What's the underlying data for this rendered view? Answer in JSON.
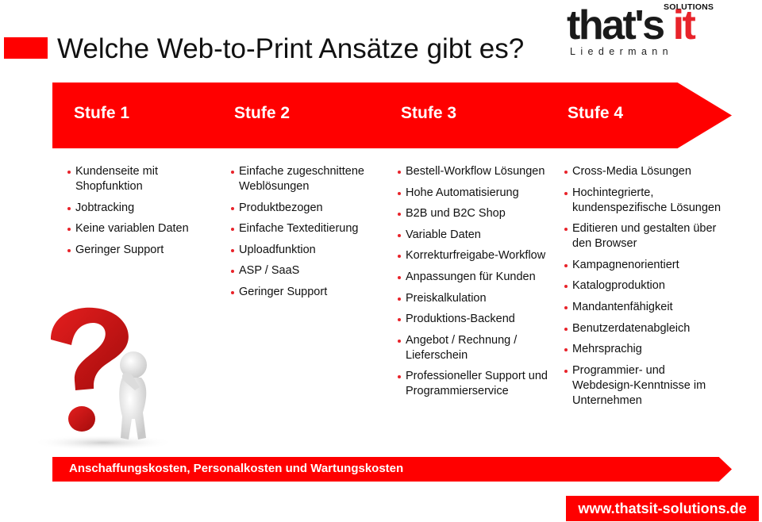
{
  "header": {
    "title": "Welche Web-to-Print Ansätze gibt es?"
  },
  "logo": {
    "wordmark_main": "that's ",
    "wordmark_accent": "it",
    "tagline_top": "SOLUTIONS",
    "tagline_bottom": "Liedermann"
  },
  "stages": [
    {
      "label": "Stufe 1",
      "items": [
        "Kundenseite mit Shopfunktion",
        "Jobtracking",
        "Keine variablen Daten",
        "Geringer Support"
      ]
    },
    {
      "label": "Stufe 2",
      "items": [
        "Einfache zugeschnittene Weblösungen",
        "Produktbezogen",
        "Einfache Texteditierung",
        "Uploadfunktion",
        "ASP / SaaS",
        "Geringer Support"
      ]
    },
    {
      "label": "Stufe 3",
      "items": [
        "Bestell-Workflow Lösungen",
        "Hohe Automatisierung",
        "B2B und B2C Shop",
        "Variable Daten",
        "Korrekturfreigabe-Workflow",
        "Anpassungen für Kunden",
        "Preiskalkulation",
        "Produktions-Backend",
        "Angebot / Rechnung / Lieferschein",
        "Professioneller Support und Programmierservice"
      ]
    },
    {
      "label": "Stufe 4",
      "items": [
        "Cross-Media Lösungen",
        "Hochintegrierte, kundenspezifische Lösungen",
        "Editieren und gestalten über den Browser",
        "Kampagnenorientiert",
        "Katalogproduktion",
        "Mandantenfähigkeit",
        "Benutzerdatenabgleich",
        "Mehrsprachig",
        "Programmier- und Webdesign-Kenntnisse im Unternehmen"
      ]
    }
  ],
  "footer": {
    "cost_label": "Anschaffungskosten, Personalkosten und Wartungskosten",
    "url": "www.thatsit-solutions.de"
  },
  "illustration": {
    "icon": "question-mark-thinking-person-icon"
  },
  "colors": {
    "accent": "#ff0000",
    "logo_red": "#e8232a",
    "text": "#111111"
  }
}
